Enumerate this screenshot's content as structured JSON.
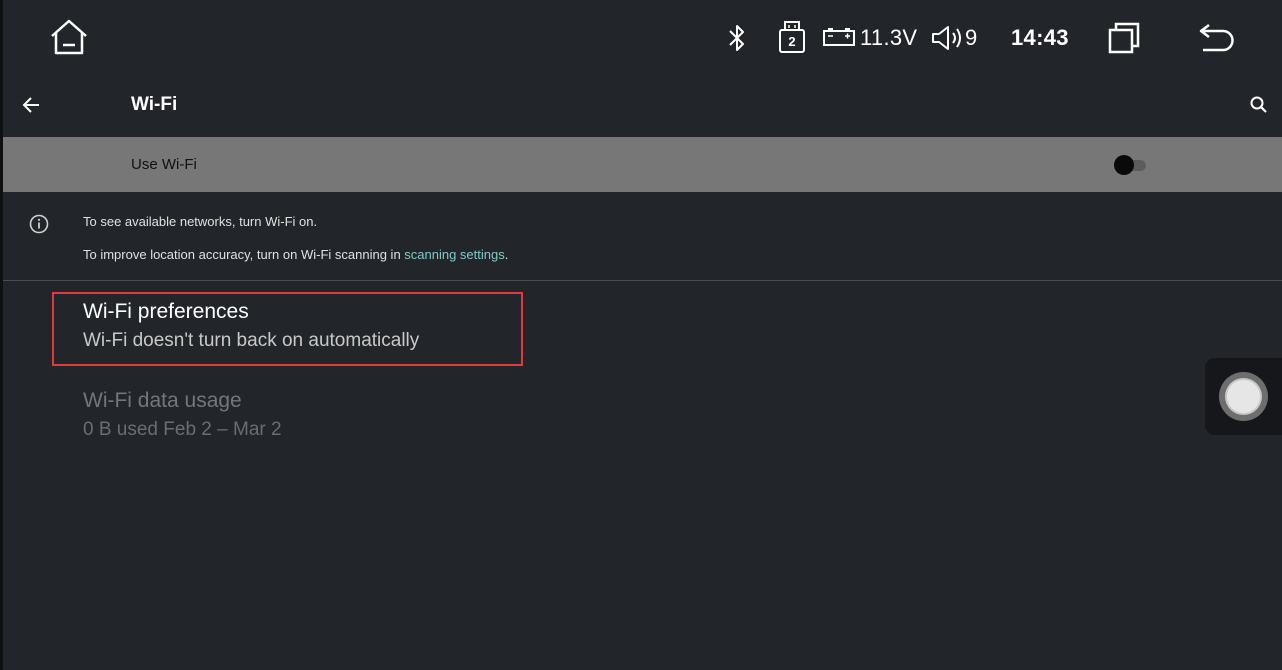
{
  "status_bar": {
    "home_icon": "home-icon",
    "bluetooth_icon": "bluetooth-icon",
    "usb_badge": "2",
    "voltage": "11.3V",
    "volume_level": "9",
    "time": "14:43",
    "recents_icon": "recents-icon",
    "back_icon": "return-icon"
  },
  "app_bar": {
    "back_icon": "arrow-back-icon",
    "title": "Wi-Fi",
    "search_icon": "search-icon"
  },
  "toggle": {
    "label": "Use Wi-Fi",
    "state": "off"
  },
  "info": {
    "line1": "To see available networks, turn Wi-Fi on.",
    "line2_prefix": "To improve location accuracy, turn on Wi-Fi scanning in ",
    "line2_link": "scanning settings",
    "line2_suffix": "."
  },
  "preferences": [
    {
      "title": "Wi-Fi preferences",
      "subtitle": "Wi-Fi doesn't turn back on automatically",
      "enabled": true,
      "highlighted": true
    },
    {
      "title": "Wi-Fi data usage",
      "subtitle": "0 B used Feb 2 – Mar 2",
      "enabled": false
    }
  ],
  "colors": {
    "background": "#222529",
    "toggle_row": "#777777",
    "link": "#80cbc4",
    "highlight": "#e03a3a"
  }
}
